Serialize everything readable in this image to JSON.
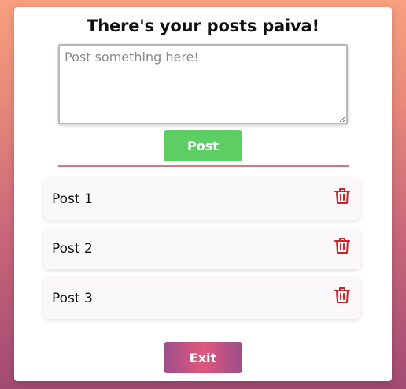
{
  "header": {
    "title": "There's your posts paiva!"
  },
  "composer": {
    "placeholder": "Post something here!",
    "value": "",
    "post_label": "Post"
  },
  "posts": [
    {
      "label": "Post 1",
      "icon": "trash-icon"
    },
    {
      "label": "Post 2",
      "icon": "trash-icon"
    },
    {
      "label": "Post 3",
      "icon": "trash-icon"
    }
  ],
  "footer": {
    "exit_label": "Exit"
  },
  "colors": {
    "post_button": "#5cce63",
    "divider": "#d97384",
    "trash_icon": "#c8242c",
    "exit_gradient_start": "#9b4f8a",
    "exit_gradient_mid": "#e0577c"
  }
}
